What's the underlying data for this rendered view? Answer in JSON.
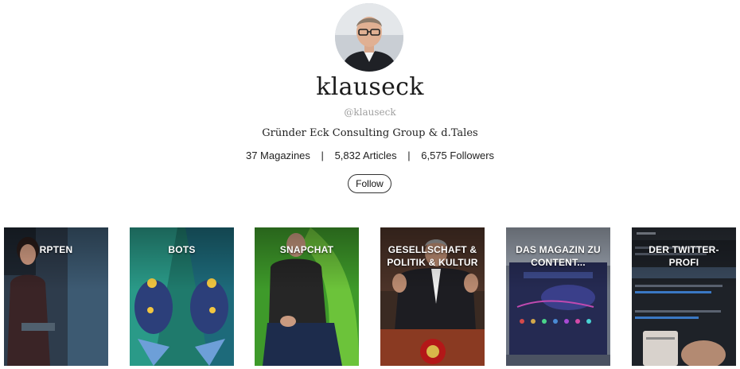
{
  "profile": {
    "name": "klauseck",
    "handle": "@klauseck",
    "bio": "Gründer Eck Consulting Group & d.Tales",
    "stats": {
      "magazines": "37 Magazines",
      "separator": "|",
      "articles": "5,832 Articles",
      "followers": "6,575 Followers"
    },
    "follow_label": "Follow"
  },
  "magazines": [
    {
      "title": "RPTEN"
    },
    {
      "title": "BOTS"
    },
    {
      "title": "SNAPCHAT"
    },
    {
      "title": "GESELLSCHAFT & POLITIK & KULTUR"
    },
    {
      "title": "DAS MAGAZIN ZU CONTENT..."
    },
    {
      "title": "DER TWITTER-PROFI"
    }
  ]
}
